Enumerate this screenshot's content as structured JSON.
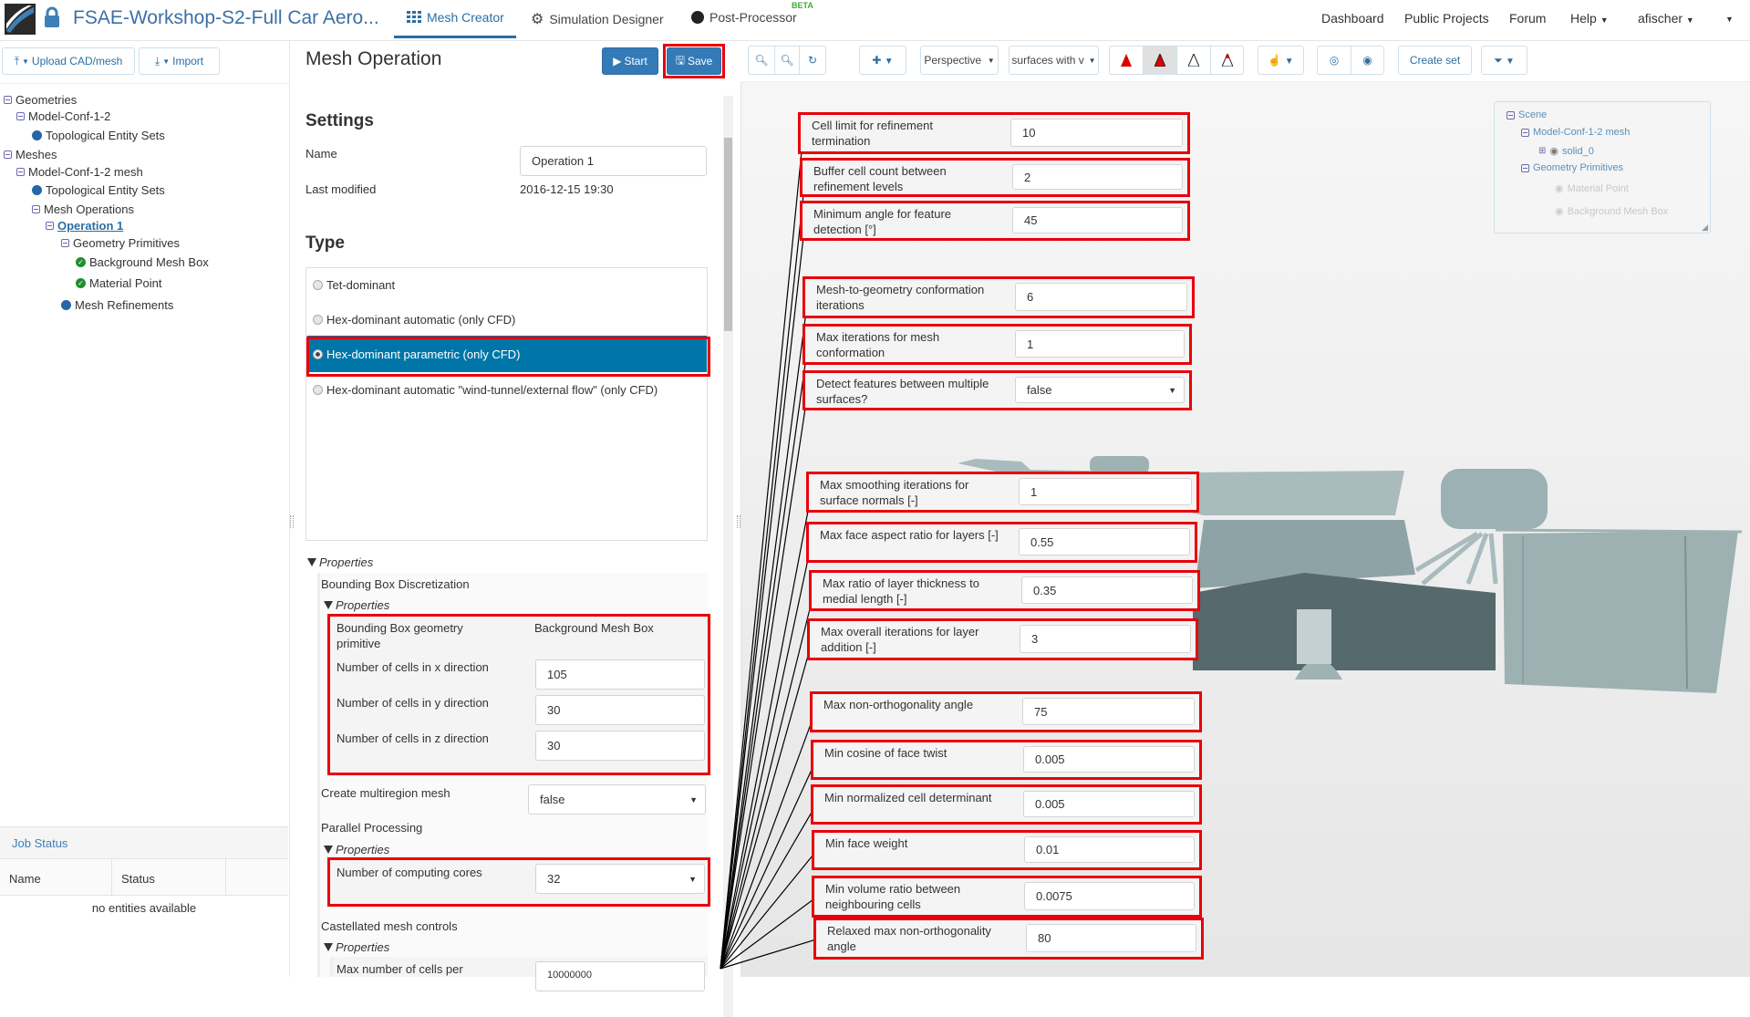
{
  "app": {
    "title": "FSAE-Workshop-S2-Full Car Aero...",
    "tabs": [
      {
        "label": "Mesh Creator",
        "icon": "grid-icon",
        "active": true
      },
      {
        "label": "Simulation Designer",
        "icon": "gears-icon"
      },
      {
        "label": "Post-Processor",
        "icon": "cog-icon",
        "badge": "BETA"
      }
    ],
    "right_nav": [
      "Dashboard",
      "Public Projects",
      "Forum",
      "Help",
      "afischer"
    ]
  },
  "left": {
    "upload_label": "Upload CAD/mesh",
    "import_label": "Import",
    "tree": [
      {
        "label": "Geometries",
        "level": 0,
        "icon": "collapse"
      },
      {
        "label": "Model-Conf-1-2",
        "level": 1,
        "icon": "collapse"
      },
      {
        "label": "Topological Entity Sets",
        "level": 2,
        "icon": "dot"
      },
      {
        "label": "Meshes",
        "level": 0,
        "icon": "collapse"
      },
      {
        "label": "Model-Conf-1-2 mesh",
        "level": 1,
        "icon": "collapse"
      },
      {
        "label": "Topological Entity Sets",
        "level": 2,
        "icon": "dot"
      },
      {
        "label": "Mesh Operations",
        "level": 2,
        "icon": "collapse"
      },
      {
        "label": "Operation 1",
        "level": 3,
        "icon": "collapse",
        "selected": true
      },
      {
        "label": "Geometry Primitives",
        "level": 4,
        "icon": "collapse"
      },
      {
        "label": "Background Mesh Box",
        "level": 5,
        "icon": "check"
      },
      {
        "label": "Material Point",
        "level": 5,
        "icon": "check"
      },
      {
        "label": "Mesh Refinements",
        "level": 4,
        "icon": "dot"
      }
    ],
    "job_status": {
      "title": "Job Status",
      "columns": [
        "Name",
        "Status"
      ],
      "empty": "no entities available"
    }
  },
  "middle": {
    "title": "Mesh Operation",
    "start_label": "Start",
    "save_label": "Save",
    "settings_heading": "Settings",
    "name_label": "Name",
    "name_value": "Operation 1",
    "last_modified_label": "Last modified",
    "last_modified_value": "2016-12-15 19:30",
    "type_heading": "Type",
    "type_options": [
      "Tet-dominant",
      "Hex-dominant automatic (only CFD)",
      "Hex-dominant parametric (only CFD)",
      "Hex-dominant automatic \"wind-tunnel/external flow\" (only CFD)"
    ],
    "type_selected": 2,
    "properties_label": "Properties",
    "bbox_heading": "Bounding Box Discretization",
    "bbox_primitive_label": "Bounding Box geometry primitive",
    "bbox_primitive_value": "Background Mesh Box",
    "cells_x_label": "Number of cells in x direction",
    "cells_x": "105",
    "cells_y_label": "Number of cells in y direction",
    "cells_y": "30",
    "cells_z_label": "Number of cells in z direction",
    "cells_z": "30",
    "multiregion_label": "Create multiregion mesh",
    "multiregion_value": "false",
    "parallel_heading": "Parallel Processing",
    "cores_label": "Number of computing cores",
    "cores_value": "32",
    "castellated_heading": "Castellated mesh controls",
    "max_cells_label": "Max number of cells per",
    "max_cells_value": "10000000"
  },
  "toolbar": {
    "projection": "Perspective",
    "render_mode": "surfaces with v",
    "create_set": "Create set"
  },
  "scene_tree": [
    {
      "label": "Scene",
      "level": 0
    },
    {
      "label": "Model-Conf-1-2 mesh",
      "level": 1
    },
    {
      "label": "solid_0",
      "level": 2
    },
    {
      "label": "Geometry Primitives",
      "level": 1
    },
    {
      "label": "Material Point",
      "level": 3
    },
    {
      "label": "Background Mesh Box",
      "level": 3
    }
  ],
  "callouts": [
    {
      "label": "Cell limit for refinement termination",
      "value": "10"
    },
    {
      "label": "Buffer cell count between refinement levels",
      "value": "2"
    },
    {
      "label": "Minimum angle for feature detection [°]",
      "value": "45"
    },
    {
      "label": "Mesh-to-geometry conformation iterations",
      "value": "6"
    },
    {
      "label": "Max iterations for mesh conformation",
      "value": "1"
    },
    {
      "label": "Detect features between multiple surfaces?",
      "value": "false",
      "select": true
    },
    {
      "label": "Max smoothing iterations for surface normals [-]",
      "value": "1"
    },
    {
      "label": "Max face aspect ratio for layers [-]",
      "value": "0.55"
    },
    {
      "label": "Max ratio of layer thickness to medial length [-]",
      "value": "0.35"
    },
    {
      "label": "Max overall iterations for layer addition [-]",
      "value": "3"
    },
    {
      "label": "Max non-orthogonality angle",
      "value": "75"
    },
    {
      "label": "Min cosine of face twist",
      "value": "0.005"
    },
    {
      "label": "Min normalized cell determinant",
      "value": "0.005"
    },
    {
      "label": "Min face weight",
      "value": "0.01"
    },
    {
      "label": "Min volume ratio between neighbouring cells",
      "value": "0.0075"
    },
    {
      "label": "Relaxed max non-orthogonality angle",
      "value": "80"
    }
  ],
  "colors": {
    "accent": "#337ab7",
    "highlight": "#e8000b",
    "selected_bg": "#0076a8",
    "car": "#9fb3b5"
  }
}
